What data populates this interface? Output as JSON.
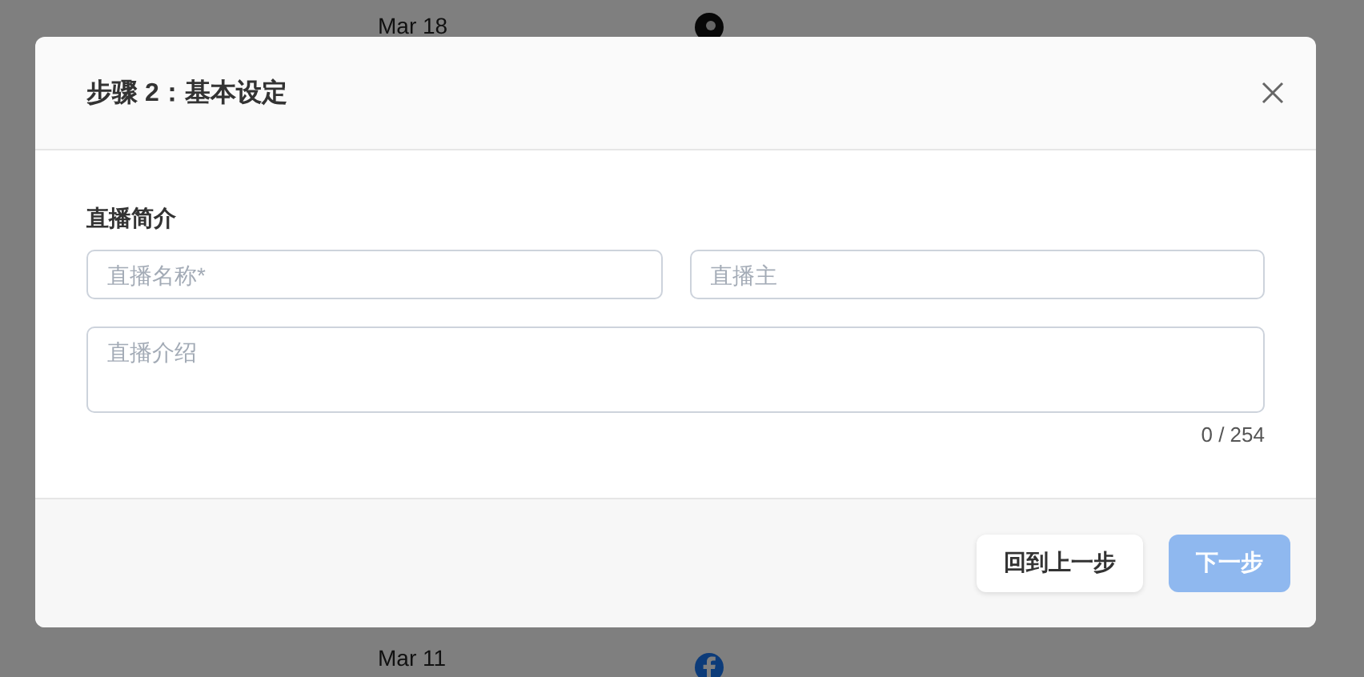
{
  "background_list": {
    "rows": [
      {
        "date": "Mar 18",
        "kind": "round"
      },
      {
        "date": "Mar 11",
        "kind": "social"
      }
    ]
  },
  "dialog": {
    "title": "步骤 2：基本设定",
    "section_title": "直播简介",
    "fields": [
      {
        "placeholder": "直播名称*"
      },
      {
        "placeholder": "直播主"
      }
    ],
    "description": {
      "placeholder": "直播介绍",
      "counter": "0 / 254"
    },
    "buttons": [
      {
        "label": "回到上一步",
        "kind": "secondary",
        "disabled": false
      },
      {
        "label": "下一步",
        "kind": "primary",
        "disabled": true
      }
    ]
  }
}
